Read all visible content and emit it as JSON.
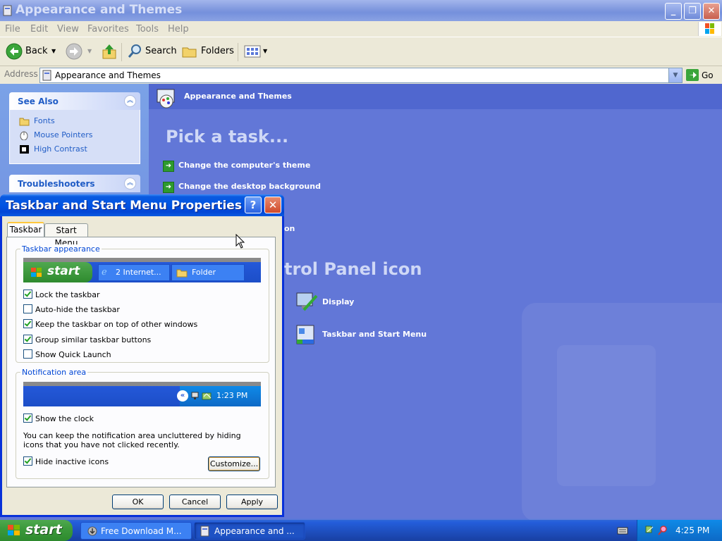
{
  "window": {
    "title": "Appearance and Themes",
    "controls": {
      "minimize": "_",
      "maximize": "❐",
      "close": "✕"
    }
  },
  "menubar": [
    "File",
    "Edit",
    "View",
    "Favorites",
    "Tools",
    "Help"
  ],
  "toolbar": {
    "back": "Back",
    "search": "Search",
    "folders": "Folders"
  },
  "address": {
    "label": "Address",
    "value": "Appearance and Themes",
    "go": "Go"
  },
  "sidebar": {
    "see_also": {
      "title": "See Also",
      "items": [
        {
          "label": "Fonts",
          "icon": "folder-icon"
        },
        {
          "label": "Mouse Pointers",
          "icon": "mouse-icon"
        },
        {
          "label": "High Contrast",
          "icon": "contrast-icon"
        }
      ]
    },
    "troubleshooters": {
      "title": "Troubleshooters"
    }
  },
  "content": {
    "header": "Appearance and Themes",
    "pick_task": "Pick a task...",
    "tasks": [
      "Change the computer's theme",
      "Change the desktop background",
      "on"
    ],
    "cp_heading": "trol Panel icon",
    "icons": [
      "Display",
      "Taskbar and Start Menu"
    ]
  },
  "dialog": {
    "title": "Taskbar and Start Menu Properties",
    "help": "?",
    "close": "✕",
    "tabs": [
      "Taskbar",
      "Start Menu"
    ],
    "appearance_group": "Taskbar appearance",
    "preview": {
      "start": "start",
      "task1": "2 Internet...",
      "task2": "Folder"
    },
    "options": [
      {
        "label": "Lock the taskbar",
        "checked": true
      },
      {
        "label": "Auto-hide the taskbar",
        "checked": false
      },
      {
        "label": "Keep the taskbar on top of other windows",
        "checked": true
      },
      {
        "label": "Group similar taskbar buttons",
        "checked": true
      },
      {
        "label": "Show Quick Launch",
        "checked": false
      }
    ],
    "notification_group": "Notification area",
    "tray_time": "1:23 PM",
    "show_clock": {
      "label": "Show the clock",
      "checked": true
    },
    "description": "You can keep the notification area uncluttered by hiding icons that you have not clicked recently.",
    "hide_inactive": {
      "label": "Hide inactive icons",
      "checked": true
    },
    "customize": "Customize...",
    "ok": "OK",
    "cancel": "Cancel",
    "apply": "Apply"
  },
  "taskbar": {
    "start": "start",
    "tasks": [
      {
        "label": "Free Download M...",
        "active": false
      },
      {
        "label": "Appearance and ...",
        "active": true
      }
    ],
    "clock": "4:25 PM"
  },
  "colors": {
    "accent": "#0054e3",
    "panel": "#6277d7",
    "dialog_face": "#ece9d8",
    "start_green": "#3c9a3c"
  }
}
